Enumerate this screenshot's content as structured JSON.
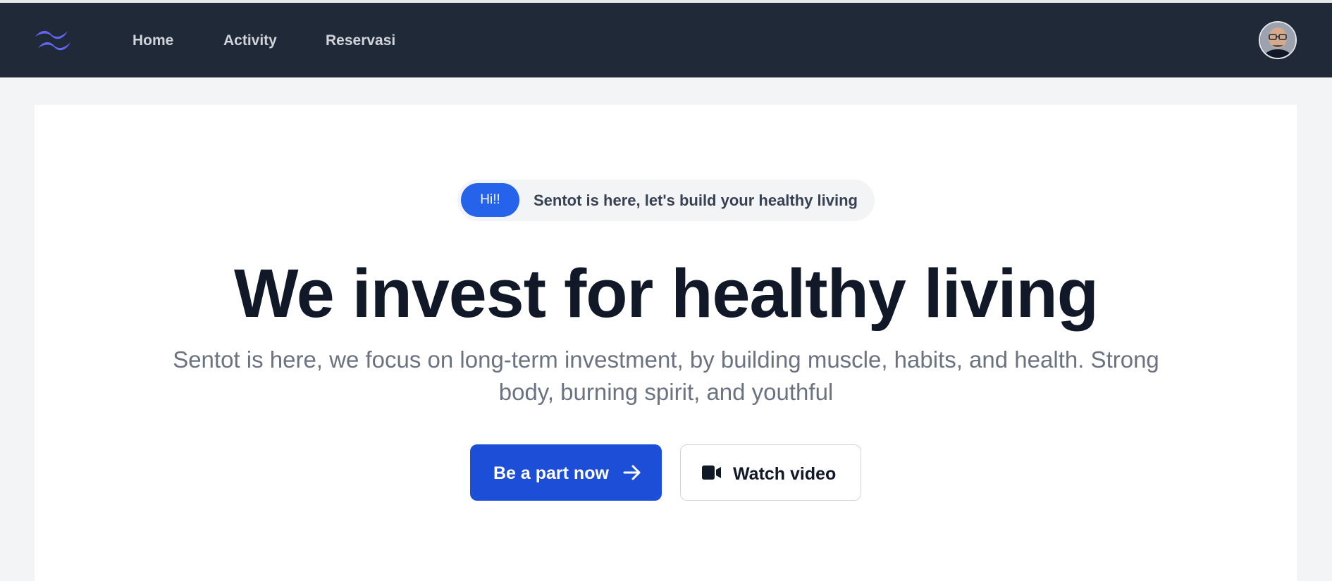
{
  "nav": {
    "links": [
      "Home",
      "Activity",
      "Reservasi"
    ],
    "logo_icon": "wave-logo-icon",
    "avatar_icon": "user-avatar"
  },
  "badge": {
    "tag": "Hi!!",
    "text": "Sentot is here, let's build your healthy living"
  },
  "hero": {
    "title": "We invest for healthy living",
    "subtitle_line1": "Sentot is here, we focus on long-term investment, by building muscle, habits, and health. Strong",
    "subtitle_line2": "body, burning spirit, and youthful"
  },
  "actions": {
    "primary_label": "Be a part now",
    "primary_icon": "arrow-right-icon",
    "secondary_label": "Watch video",
    "secondary_icon": "video-camera-icon"
  },
  "colors": {
    "navbar": "#1f2937",
    "accent": "#2563eb",
    "primary_button": "#1d4ed8",
    "logo": "#6366f1"
  }
}
